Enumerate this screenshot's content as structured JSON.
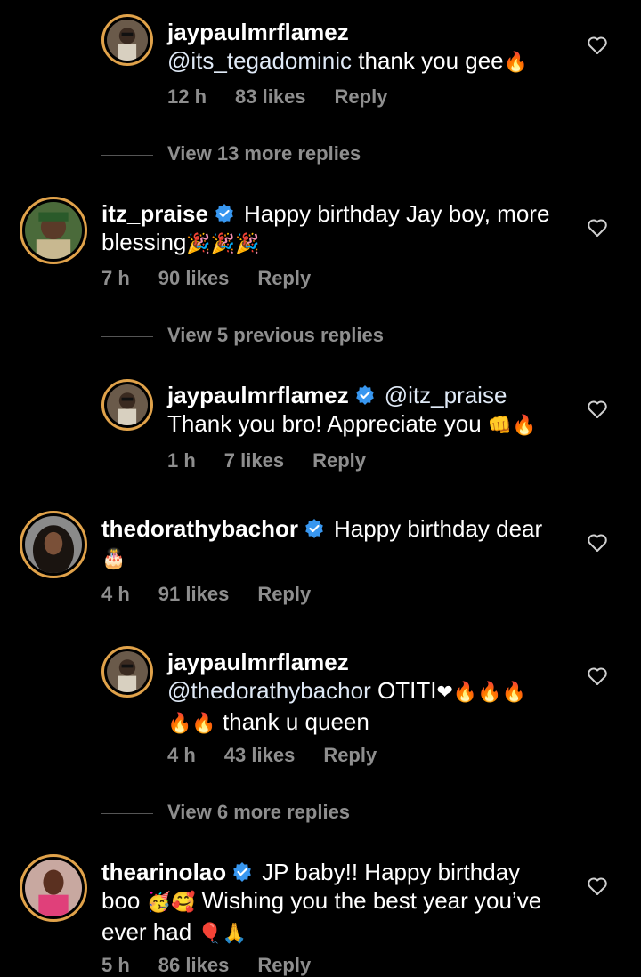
{
  "comments": [
    {
      "username": "jaypaulmrflamez",
      "verified": false,
      "line1_mention": "@its_tegadominic",
      "line1_text": " thank you gee",
      "line1_emoji": "🔥",
      "time": "12 h",
      "likes": "83 likes",
      "reply": "Reply"
    },
    {
      "username": "itz_praise",
      "verified": true,
      "line1_text": "Happy birthday Jay boy, more",
      "line2_text": "blessing",
      "line2_emoji": "🎉🎉🎉",
      "time": "7 h",
      "likes": "90 likes",
      "reply": "Reply"
    },
    {
      "username": "jaypaulmrflamez",
      "verified": true,
      "line1_mention": "@itz_praise",
      "line2_text": "Thank you bro! Appreciate you ",
      "line2_emoji": "👊🔥",
      "time": "1 h",
      "likes": "7 likes",
      "reply": "Reply"
    },
    {
      "username": "thedorathybachor",
      "verified": true,
      "line1_text": "Happy birthday dear",
      "line2_emoji": "🎂",
      "time": "4 h",
      "likes": "91 likes",
      "reply": "Reply"
    },
    {
      "username": "jaypaulmrflamez",
      "verified": false,
      "line1_mention": "@thedorathybachor",
      "line1_text": " OTITI",
      "line1_emoji": "❤🔥🔥🔥",
      "line2_emoji": "🔥🔥",
      "line2_text": " thank u queen",
      "time": "4 h",
      "likes": "43 likes",
      "reply": "Reply"
    },
    {
      "username": "thearinolao",
      "verified": true,
      "line1_text": "JP baby!! Happy birthday",
      "line2_text": "boo ",
      "line2_emoji": "🥳🥰",
      "line2_text_b": " Wishing you the best year you’ve",
      "line3_text": "ever had ",
      "line3_emoji": "🎈🙏",
      "time": "5 h",
      "likes": "86 likes",
      "reply": "Reply"
    }
  ],
  "view_replies": {
    "first": "View 13 more replies",
    "second": "View 5 previous replies",
    "third": "View 6 more replies"
  },
  "icons": {
    "heart": "heart-outline-icon",
    "verified": "verified-badge-icon"
  },
  "colors": {
    "background": "#000000",
    "meta": "#8e8e8e",
    "verified_blue": "#3897f0",
    "avatar_ring": "#e0a24a"
  }
}
